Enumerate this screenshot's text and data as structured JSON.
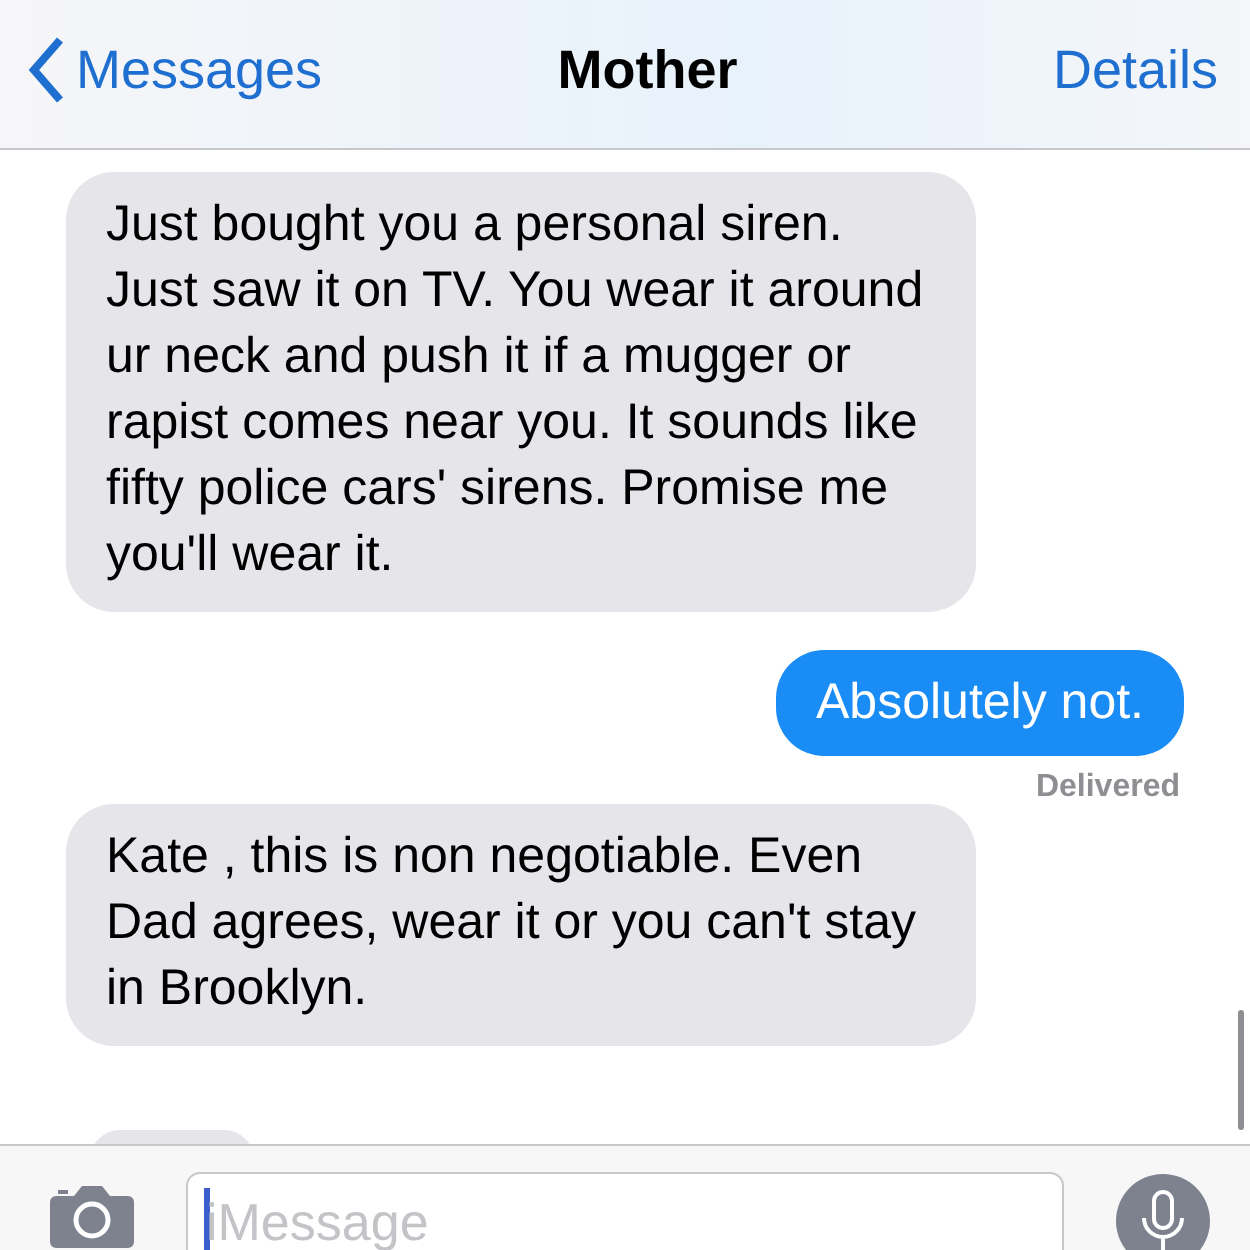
{
  "nav": {
    "back": "Messages",
    "title": "Mother",
    "action": "Details"
  },
  "messages": [
    {
      "kind": "incoming",
      "text": "Just bought you a personal siren. Just saw it on TV. You wear it around ur neck and push it if a mugger or rapist comes near you. It sounds like fifty police cars' sirens. Promise me you'll wear it."
    },
    {
      "kind": "outgoing",
      "text": "Absolutely not.",
      "status": "Delivered"
    },
    {
      "kind": "incoming",
      "text": "Kate , this is non negotiable. Even Dad agrees, wear it or you can't stay in Brooklyn."
    }
  ],
  "composer": {
    "placeholder": "iMessage"
  }
}
